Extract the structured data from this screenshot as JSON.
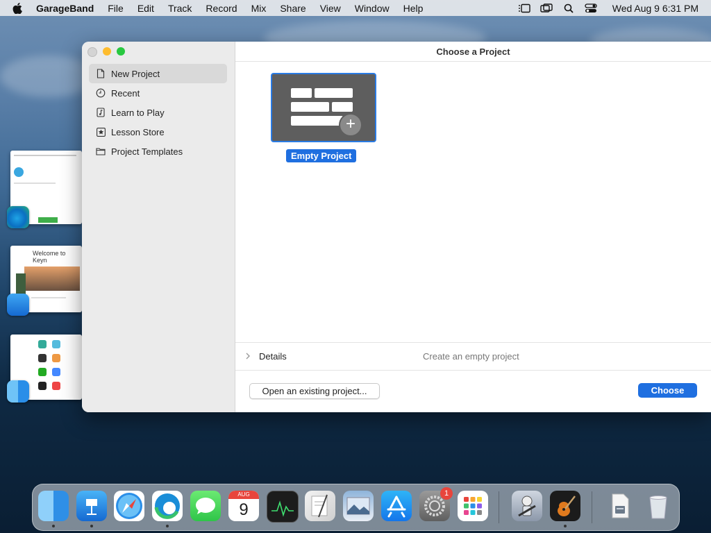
{
  "menubar": {
    "app_name": "GarageBand",
    "menus": [
      "File",
      "Edit",
      "Track",
      "Record",
      "Mix",
      "Share",
      "View",
      "Window",
      "Help"
    ],
    "clock": "Wed Aug 9  6:31 PM"
  },
  "window": {
    "title": "Choose a Project",
    "sidebar": [
      {
        "label": "New Project",
        "icon": "document-icon",
        "selected": true
      },
      {
        "label": "Recent",
        "icon": "clock-icon",
        "selected": false
      },
      {
        "label": "Learn to Play",
        "icon": "music-note-icon",
        "selected": false
      },
      {
        "label": "Lesson Store",
        "icon": "star-icon",
        "selected": false
      },
      {
        "label": "Project Templates",
        "icon": "folder-icon",
        "selected": false
      }
    ],
    "tile_label": "Empty Project",
    "details_label": "Details",
    "details_desc": "Create an empty project",
    "open_button": "Open an existing project...",
    "choose_button": "Choose"
  },
  "dock": {
    "calendar_month": "AUG",
    "calendar_day": "9",
    "settings_badge": "1"
  },
  "colors": {
    "accent": "#1f6fe0",
    "sidebar_bg": "#ebebeb"
  }
}
